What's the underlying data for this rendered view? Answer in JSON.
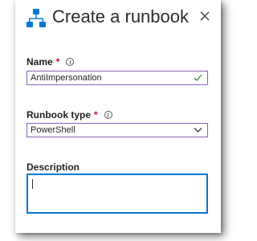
{
  "dialog": {
    "title": "Create a runbook",
    "icon": "runbook-hierarchy-icon",
    "close_icon": "close-icon"
  },
  "fields": {
    "name": {
      "label": "Name",
      "required_marker": "*",
      "value": "AntiImpersonation",
      "status_icon": "checkmark-icon"
    },
    "runbook_type": {
      "label": "Runbook type",
      "required_marker": "*",
      "value": "PowerShell"
    },
    "description": {
      "label": "Description",
      "value": ""
    }
  },
  "colors": {
    "accent_purple": "#8764b8",
    "focus_blue": "#0078d4",
    "required_red": "#c50f1f",
    "icon_blue": "#0078d4",
    "check_green": "#3b8f3b"
  }
}
